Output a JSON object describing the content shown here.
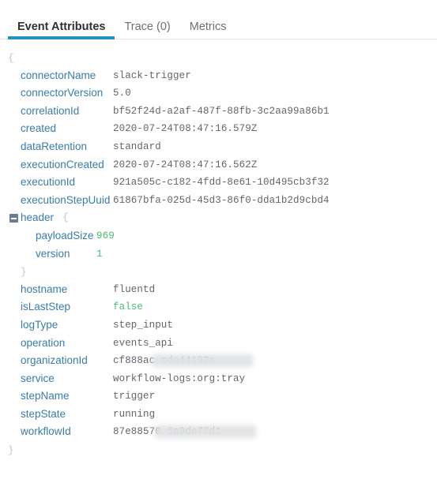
{
  "tabs": [
    {
      "label": "Event Attributes",
      "active": true
    },
    {
      "label": "Trace (0)",
      "active": false
    },
    {
      "label": "Metrics",
      "active": false
    }
  ],
  "json_viewer": {
    "open_brace": "{",
    "close_brace": "}",
    "nested_close_brace": "}",
    "object_open_brace": "{",
    "rows": [
      {
        "key": "connectorName",
        "value": "slack-trigger"
      },
      {
        "key": "connectorVersion",
        "value": "5.0"
      },
      {
        "key": "correlationId",
        "value": "bf52f24d-a2af-487f-88fb-3c2aa99a86b1"
      },
      {
        "key": "created",
        "value": "2020-07-24T08:47:16.579Z"
      },
      {
        "key": "dataRetention",
        "value": "standard"
      },
      {
        "key": "executionCreated",
        "value": "2020-07-24T08:47:16.562Z"
      },
      {
        "key": "executionId",
        "value": "921a505c-c182-4fdd-8e61-10d495cb3f32"
      },
      {
        "key": "executionStepUuid",
        "value": "61867bfa-025d-45d3-86f0-dda1b2d9cbd4"
      }
    ],
    "header_object": {
      "key": "header",
      "children": [
        {
          "key": "payloadSize",
          "value": "969",
          "type": "number"
        },
        {
          "key": "version",
          "value": "1",
          "type": "number"
        }
      ]
    },
    "rows_after": [
      {
        "key": "hostname",
        "value": "fluentd"
      },
      {
        "key": "isLastStep",
        "value": "false",
        "type": "boolean"
      },
      {
        "key": "logType",
        "value": "step_input"
      },
      {
        "key": "operation",
        "value": "events_api"
      },
      {
        "key": "organizationId",
        "value": "cf888ac                         cde44192a",
        "redacted": true
      },
      {
        "key": "service",
        "value": "workflow-logs:org:tray"
      },
      {
        "key": "stepName",
        "value": "trigger"
      },
      {
        "key": "stepState",
        "value": "running"
      },
      {
        "key": "workflowId",
        "value": "87e88570                        6a9de77d1",
        "redacted": true
      }
    ]
  },
  "colors": {
    "accent": "#2790c3",
    "key": "#3a7ca8",
    "value": "#61666d",
    "literal": "#4cbb72",
    "brace": "#c3c7cb",
    "border": "#e2e4e7"
  }
}
